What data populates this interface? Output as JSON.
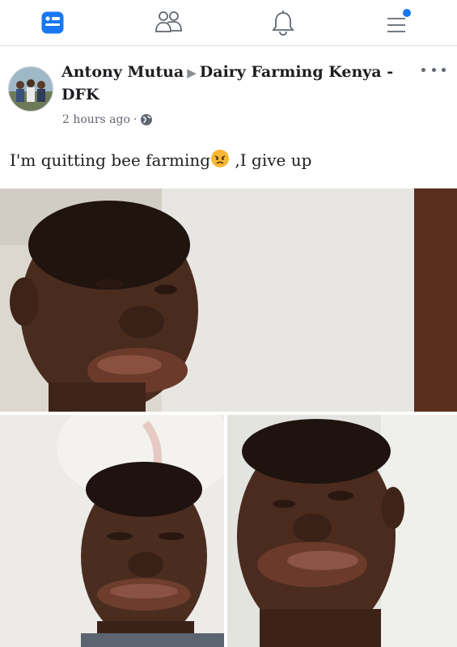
{
  "nav": {
    "items": [
      {
        "name": "feed-icon",
        "active": true
      },
      {
        "name": "friends-icon",
        "active": false
      },
      {
        "name": "notifications-bell-icon",
        "active": false
      },
      {
        "name": "menu-icon",
        "active": false,
        "badge": true
      }
    ],
    "accent_color": "#1877f2"
  },
  "post": {
    "author": "Antony Mutua",
    "group": "Dairy Farming Kenya - DFK",
    "timestamp": "2 hours ago",
    "privacy_icon": "globe-icon",
    "text_before": "I'm quitting bee farming",
    "emoji": "angry-face-emoji",
    "text_after": " ,I give up",
    "photos": [
      {
        "name": "photo-top",
        "subject": "man with swollen lip, side view"
      },
      {
        "name": "photo-bottom-left",
        "subject": "man with swollen lips, front view"
      },
      {
        "name": "photo-bottom-right",
        "subject": "man with swollen lip, angled view"
      }
    ]
  }
}
